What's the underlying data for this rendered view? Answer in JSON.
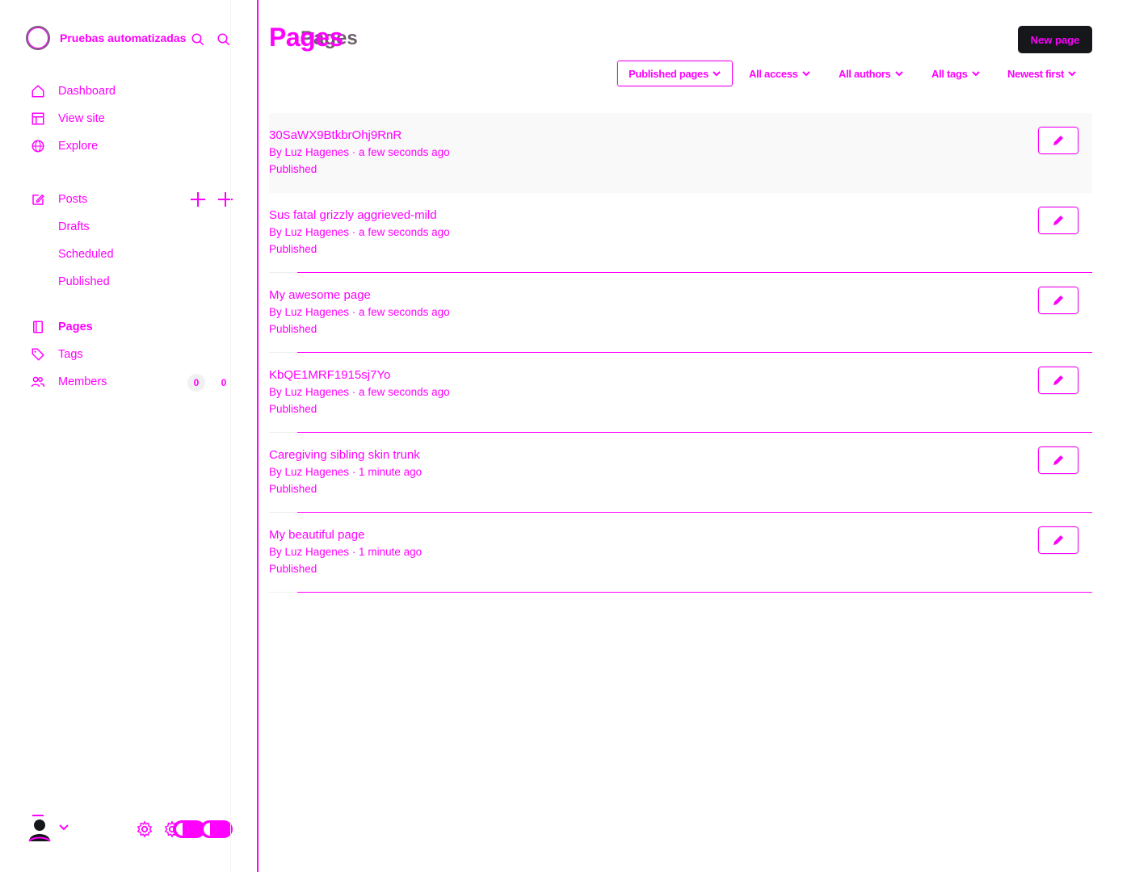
{
  "site": {
    "title": "Pruebas automatizadas"
  },
  "nav": {
    "dashboard": "Dashboard",
    "view_site": "View site",
    "explore": "Explore",
    "posts": "Posts",
    "drafts": "Drafts",
    "scheduled": "Scheduled",
    "published": "Published",
    "pages": "Pages",
    "tags": "Tags",
    "members": "Members",
    "members_count": "0",
    "members_count_dup": "0"
  },
  "header": {
    "title": "Pages",
    "new_page_label": "New page"
  },
  "filters": {
    "status": "Published pages",
    "access": "All access",
    "authors": "All authors",
    "tags": "All tags",
    "sort": "Newest first"
  },
  "pages": [
    {
      "title": "30SaWX9BtkbrOhj9RnR",
      "meta": "By Luz Hagenes · a few seconds ago",
      "status": "Published"
    },
    {
      "title": "Sus fatal grizzly aggrieved-mild",
      "meta": "By Luz Hagenes · a few seconds ago",
      "status": "Published"
    },
    {
      "title": "My awesome page",
      "meta": "By Luz Hagenes · a few seconds ago",
      "status": "Published"
    },
    {
      "title": "KbQE1MRF1915sj7Yo",
      "meta": "By Luz Hagenes · a few seconds ago",
      "status": "Published"
    },
    {
      "title": "Caregiving sibling skin trunk",
      "meta": "By Luz Hagenes · 1 minute ago",
      "status": "Published"
    },
    {
      "title": "My beautiful page",
      "meta": "By Luz Hagenes · 1 minute ago",
      "status": "Published"
    }
  ],
  "icons": {
    "search": "search-icon",
    "dashboard": "home-icon",
    "view_site": "layout-icon",
    "explore": "globe-icon",
    "posts": "edit-icon",
    "pages": "page-icon",
    "tags": "tag-icon",
    "members": "members-icon",
    "settings": "gear-icon",
    "edit": "pencil-icon"
  },
  "colors": {
    "accent": "#ff00ff",
    "button_dark": "#15171a",
    "row_highlight": "#f9f9f9"
  }
}
